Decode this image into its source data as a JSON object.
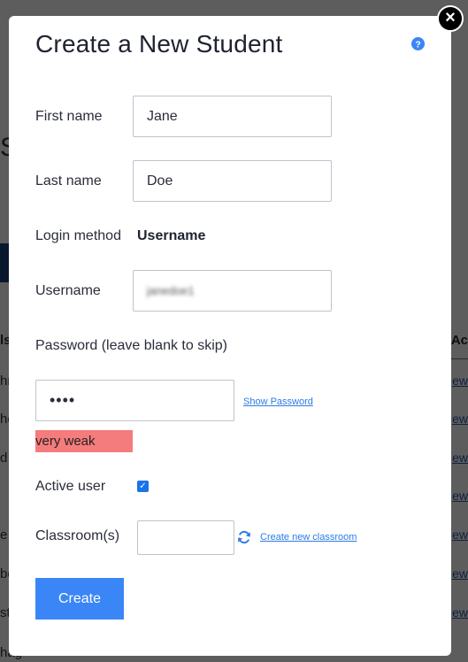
{
  "modal": {
    "title": "Create a New Student",
    "close_label": "×",
    "help_icon": "question-circle-icon"
  },
  "form": {
    "first_name": {
      "label": "First name",
      "value": "Jane"
    },
    "last_name": {
      "label": "Last name",
      "value": "Doe"
    },
    "login_method": {
      "label": "Login method",
      "value": "Username"
    },
    "username": {
      "label": "Username",
      "value": "janedoe1"
    },
    "password": {
      "label": "Password (leave blank to skip)",
      "value": "••••",
      "show_link": "Show Password",
      "strength": "very weak",
      "strength_color": "#f47c7c"
    },
    "active_user": {
      "label": "Active user",
      "checked": true
    },
    "classroom": {
      "label": "Classroom(s)",
      "value": "",
      "refresh_icon": "refresh-icon",
      "create_link": "Create new classroom"
    },
    "submit_label": "Create"
  },
  "background": {
    "heading_fragment": "S",
    "table_header_left": "ls",
    "table_header_right": "Ac",
    "row_fragments": [
      "hn",
      "he",
      "d",
      "e",
      "be",
      "st",
      "hag"
    ],
    "row_link": "ew"
  },
  "colors": {
    "accent": "#3b86f7",
    "link": "#2b7be4",
    "overlay": "#5d5d5d"
  }
}
